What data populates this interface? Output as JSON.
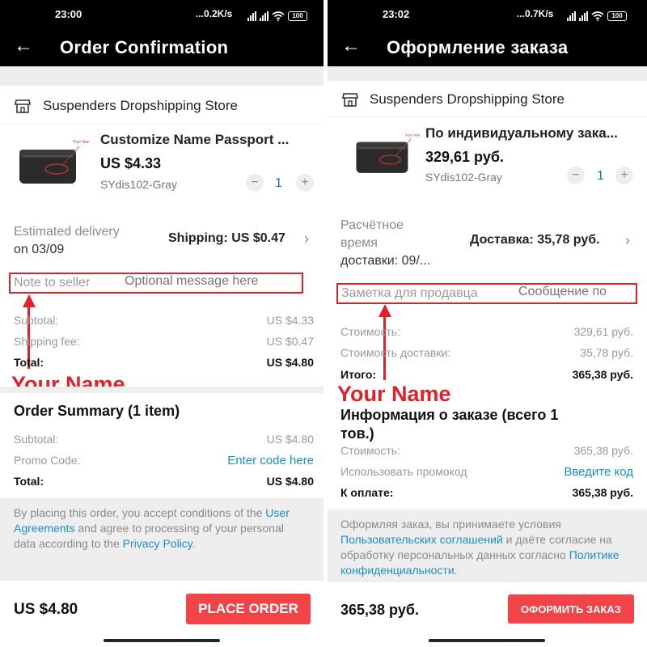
{
  "left": {
    "status": {
      "time": "23:00",
      "net": "...0.2K/s",
      "battery": "100"
    },
    "title": "Order Confirmation",
    "store": "Suspenders Dropshipping Store",
    "product": {
      "title": "Customize Name Passport ...",
      "price": "US $4.33",
      "sku": "SYdis102-Gray",
      "qty": "1",
      "minus": "−",
      "plus": "+"
    },
    "delivery": {
      "label1": "Estimated delivery",
      "label2": "on 03/09",
      "shipping": "Shipping: US $0.47"
    },
    "note": {
      "label": "Note to seller",
      "placeholder": "Optional message here"
    },
    "annotation": "Your Name",
    "costs": [
      {
        "label": "Subtotal:",
        "value": "US $4.33"
      },
      {
        "label": "Shipping fee:",
        "value": "US $0.47"
      },
      {
        "label": "Total:",
        "value": "US $4.80"
      }
    ],
    "summary": {
      "title": "Order Summary (1 item)",
      "subtotal_label": "Subtotal:",
      "subtotal_value": "US $4.80",
      "promo_label": "Promo Code:",
      "promo_link": "Enter code here",
      "total_label": "Total:",
      "total_value": "US $4.80"
    },
    "terms": {
      "t1": "By placing this order, you accept conditions of the ",
      "link1": "User Agreements",
      "t2": " and agree to processing of your personal data according to the ",
      "link2": "Privacy Policy",
      "t3": "."
    },
    "footer": {
      "total": "US $4.80",
      "button": "PLACE ORDER"
    }
  },
  "right": {
    "status": {
      "time": "23:02",
      "net": "...0.7K/s",
      "battery": "100"
    },
    "title": "Оформление заказа",
    "store": "Suspenders Dropshipping Store",
    "product": {
      "title": "По индивидуальному зака...",
      "price": "329,61 руб.",
      "sku": "SYdis102-Gray",
      "qty": "1",
      "minus": "−",
      "plus": "+"
    },
    "delivery": {
      "label1": "Расчётное",
      "label2": "время",
      "label3": "доставки: 09/...",
      "shipping": "Доставка: 35,78 руб."
    },
    "note": {
      "label": "Заметка для продавца",
      "placeholder": "Сообщение по"
    },
    "annotation": "Your Name",
    "costs": [
      {
        "label": "Стоимость:",
        "value": "329,61 руб."
      },
      {
        "label": "Стоимость доставки:",
        "value": "35,78 руб."
      },
      {
        "label": "Итого:",
        "value": "365,38 руб."
      }
    ],
    "summary": {
      "title1": "Информация о заказе (всего 1",
      "title2": "тов.)",
      "subtotal_label": "Стоимость:",
      "subtotal_value": "365,38 руб.",
      "promo_label": "Использовать промокод",
      "promo_link": "Введите код",
      "total_label": "К оплате:",
      "total_value": "365,38 руб."
    },
    "terms": {
      "t1": "Оформляя заказ, вы принимаете условия ",
      "link1": "Пользовательских соглашений",
      "t2": " и даёте согласие на обработку персональных данных согласно ",
      "link2": "Политике конфиденциальности",
      "t3": "."
    },
    "footer": {
      "total": "365,38 руб.",
      "button": "ОФОРМИТЬ ЗАКАЗ"
    }
  },
  "colors": {
    "accent_red": "#f24346",
    "annotation_red": "#e0202a",
    "link_blue": "#1a8fc4"
  },
  "icons": [
    "back-arrow-icon",
    "store-icon",
    "chevron-right-icon",
    "wifi-icon",
    "signal-icon",
    "battery-icon"
  ]
}
